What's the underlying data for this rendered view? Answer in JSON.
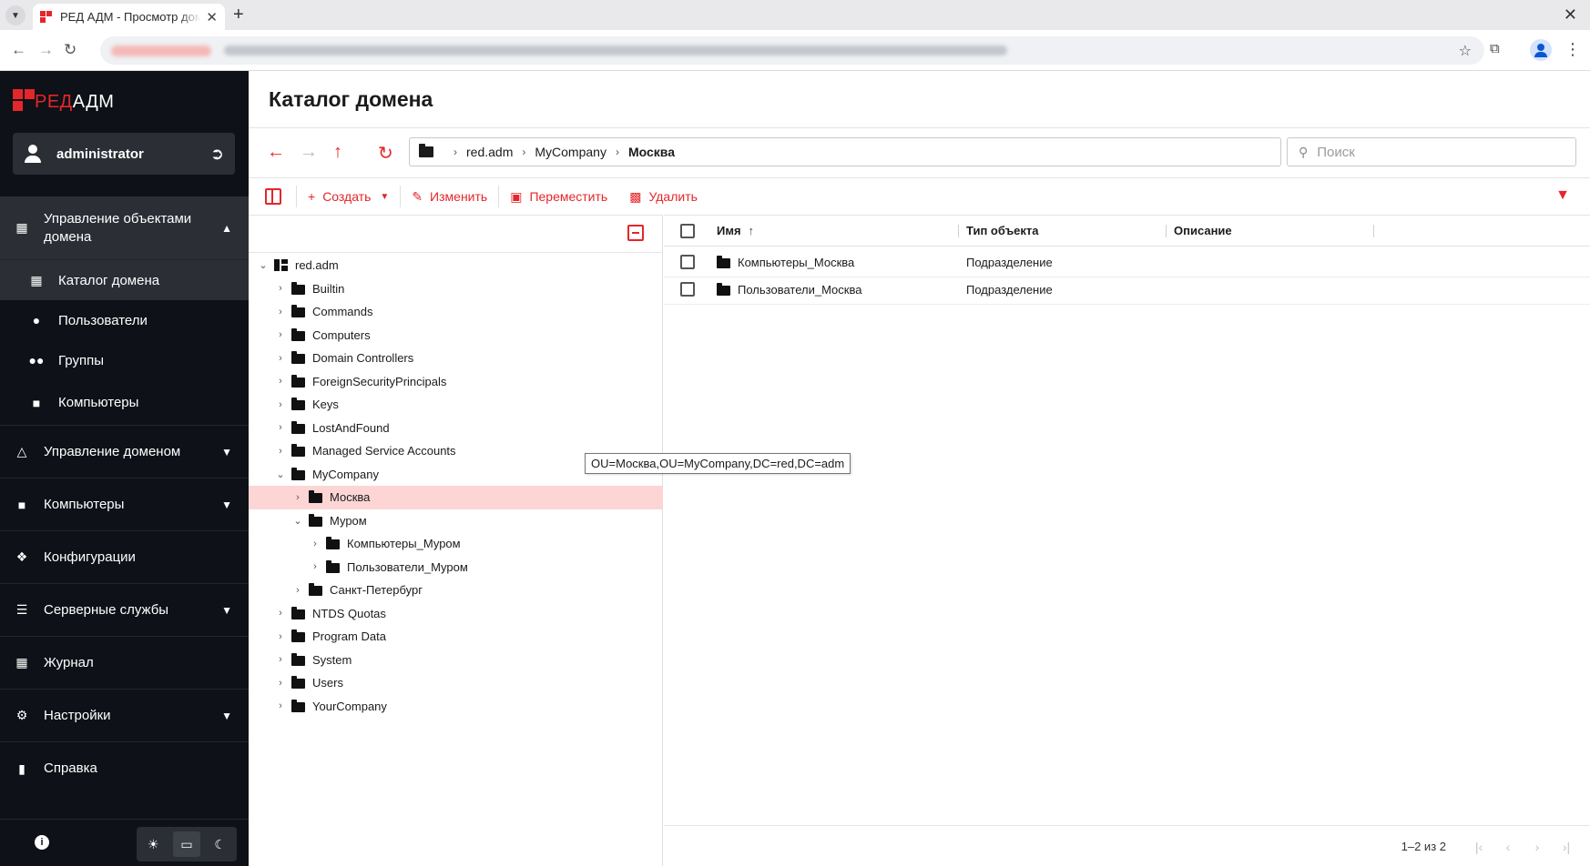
{
  "browser": {
    "tab_title": "РЕД АДМ - Просмотр домена",
    "new_tab": "+",
    "close_window": "✕"
  },
  "app": {
    "logo_red": "РЕД",
    "logo_white": "АДМ",
    "user_name": "administrator"
  },
  "sidebar": {
    "group_open": {
      "label": "Управление объектами домена"
    },
    "sub_items": [
      {
        "label": "Каталог домена",
        "icon": "tree-icon",
        "active": true
      },
      {
        "label": "Пользователи",
        "icon": "user-icon"
      },
      {
        "label": "Группы",
        "icon": "group-icon"
      },
      {
        "label": "Компьютеры",
        "icon": "monitor-icon"
      }
    ],
    "items": [
      {
        "label": "Управление доменом",
        "icon": "sitemap-icon",
        "expandable": true
      },
      {
        "label": "Компьютеры",
        "icon": "monitor-icon",
        "expandable": true
      },
      {
        "label": "Конфигурации",
        "icon": "hub-icon",
        "expandable": false
      },
      {
        "label": "Серверные службы",
        "icon": "list-icon",
        "expandable": true
      },
      {
        "label": "Журнал",
        "icon": "calendar-icon",
        "expandable": false
      },
      {
        "label": "Настройки",
        "icon": "gear-icon",
        "expandable": true
      },
      {
        "label": "Справка",
        "icon": "book-icon",
        "expandable": false
      }
    ]
  },
  "main": {
    "title": "Каталог домена",
    "breadcrumb": [
      "red.adm",
      "MyCompany",
      "Москва"
    ],
    "search_placeholder": "Поиск",
    "toolbar": {
      "create": "Создать",
      "edit": "Изменить",
      "move": "Переместить",
      "delete": "Удалить"
    }
  },
  "tree": {
    "root": "red.adm",
    "nodes": [
      {
        "label": "Builtin",
        "level": 1,
        "expanded": false
      },
      {
        "label": "Commands",
        "level": 1,
        "expanded": false
      },
      {
        "label": "Computers",
        "level": 1,
        "expanded": false
      },
      {
        "label": "Domain Controllers",
        "level": 1,
        "expanded": false
      },
      {
        "label": "ForeignSecurityPrincipals",
        "level": 1,
        "expanded": false
      },
      {
        "label": "Keys",
        "level": 1,
        "expanded": false
      },
      {
        "label": "LostAndFound",
        "level": 1,
        "expanded": false
      },
      {
        "label": "Managed Service Accounts",
        "level": 1,
        "expanded": false
      },
      {
        "label": "MyCompany",
        "level": 1,
        "expanded": true
      },
      {
        "label": "Москва",
        "level": 2,
        "expanded": false,
        "selected": true
      },
      {
        "label": "Муром",
        "level": 2,
        "expanded": true
      },
      {
        "label": "Компьютеры_Муром",
        "level": 3,
        "expanded": false
      },
      {
        "label": "Пользователи_Муром",
        "level": 3,
        "expanded": false
      },
      {
        "label": "Санкт-Петербург",
        "level": 2,
        "expanded": false
      },
      {
        "label": "NTDS Quotas",
        "level": 1,
        "expanded": false
      },
      {
        "label": "Program Data",
        "level": 1,
        "expanded": false
      },
      {
        "label": "System",
        "level": 1,
        "expanded": false
      },
      {
        "label": "Users",
        "level": 1,
        "expanded": false
      },
      {
        "label": "YourCompany",
        "level": 1,
        "expanded": false
      }
    ],
    "tooltip": "OU=Москва,OU=MyCompany,DC=red,DC=adm"
  },
  "table": {
    "columns": {
      "name": "Имя",
      "type": "Тип объекта",
      "description": "Описание"
    },
    "rows": [
      {
        "name": "Компьютеры_Москва",
        "type": "Подразделение",
        "description": ""
      },
      {
        "name": "Пользователи_Москва",
        "type": "Подразделение",
        "description": ""
      }
    ],
    "pagination": "1–2 из 2"
  },
  "colors": {
    "accent": "#e5262a",
    "sidebar_bg": "#0e1117",
    "selected_row": "#fdd5d5"
  }
}
